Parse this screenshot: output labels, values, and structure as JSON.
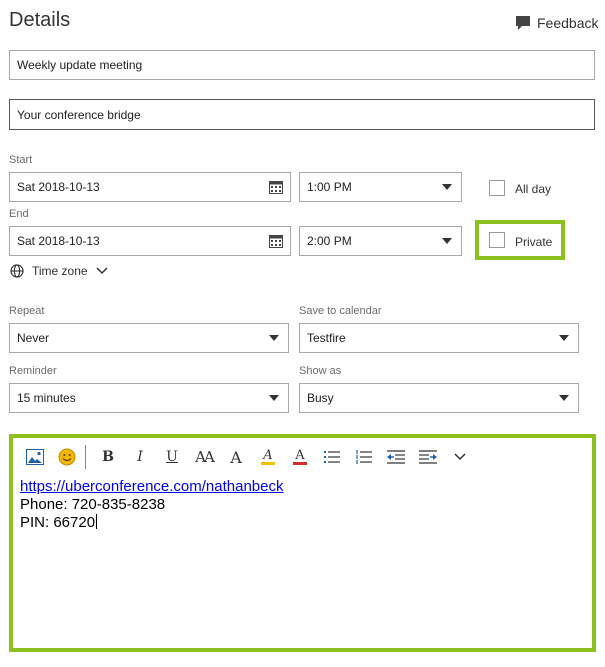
{
  "header": {
    "title": "Details",
    "feedback_label": "Feedback"
  },
  "event": {
    "title_value": "Weekly update meeting",
    "location_value": "Your conference bridge"
  },
  "start": {
    "label": "Start",
    "date": "Sat 2018-10-13",
    "time": "1:00 PM"
  },
  "end": {
    "label": "End",
    "date": "Sat 2018-10-13",
    "time": "2:00 PM"
  },
  "all_day": {
    "label": "All day",
    "checked": false
  },
  "private": {
    "label": "Private",
    "checked": false
  },
  "timezone": {
    "label": "Time zone"
  },
  "repeat": {
    "label": "Repeat",
    "value": "Never"
  },
  "save_to_calendar": {
    "label": "Save to calendar",
    "value": "Testfire"
  },
  "reminder": {
    "label": "Reminder",
    "value": "15 minutes"
  },
  "show_as": {
    "label": "Show as",
    "value": "Busy"
  },
  "toolbar": {
    "bold": "B",
    "italic": "I",
    "underline": "U",
    "font_size": "AA",
    "grow_font": "A",
    "highlight": "A",
    "font_color": "A"
  },
  "body": {
    "link": "https://uberconference.com/nathanbeck",
    "phone": "Phone: 720-835-8238",
    "pin": "PIN: 66720"
  },
  "colors": {
    "highlight_border": "#8cc11f",
    "link": "#0000ee",
    "image_icon": "#1f5fa8",
    "emoji_icon": "#f2b600",
    "highlight_bar": "#f2c200",
    "font_color_bar": "#d32f2f"
  }
}
